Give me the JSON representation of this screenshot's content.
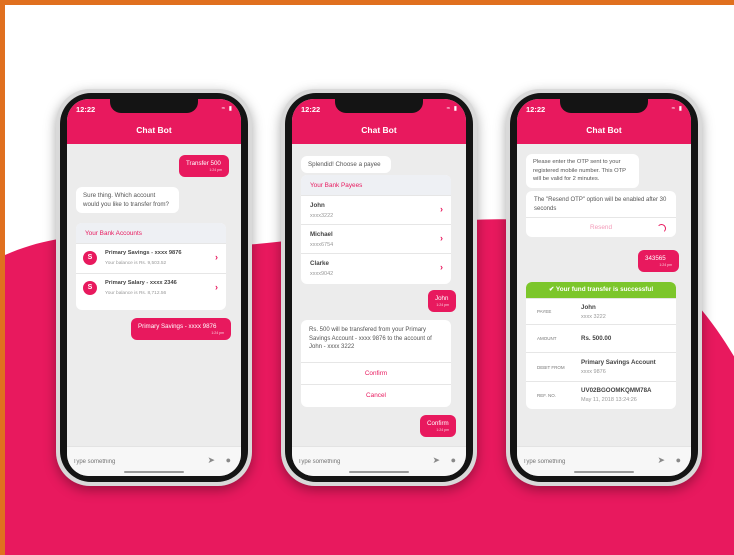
{
  "colors": {
    "accent": "#e8195e",
    "success": "#7cc62b",
    "frame": "#e0701f"
  },
  "common": {
    "time": "12:22",
    "title": "Chat Bot",
    "placeholder": "Type something",
    "send_icon": "send-icon",
    "mic_icon": "mic-icon",
    "tick": "1:24 pm"
  },
  "screen1": {
    "user_msg_1": "Transfer 500",
    "bot_msg_1": "Sure thing. Which account would you like to transfer from?",
    "accounts_title": "Your Bank Accounts",
    "accounts": [
      {
        "avatar": "S",
        "name": "Primary Savings - xxxx 9876",
        "balance": "Your balance is Rs. 9,503.52"
      },
      {
        "avatar": "S",
        "name": "Primary Salary - xxxx 2346",
        "balance": "Your balance is Rs. 8,712.56"
      }
    ],
    "user_msg_2": "Primary Savings - xxxx 9876"
  },
  "screen2": {
    "bot_msg_1": "Splendid! Choose a payee",
    "payees_title": "Your Bank Payees",
    "payees": [
      {
        "name": "John",
        "account": "xxxx3222"
      },
      {
        "name": "Michael",
        "account": "xxxx6754"
      },
      {
        "name": "Clarke",
        "account": "xxxx9042"
      }
    ],
    "user_msg_1": "John",
    "confirm_text": "Rs. 500 will be transfered from your Primary Savings Account - xxxx 9876 to the account of John - xxxx 3222",
    "confirm_label": "Confirm",
    "cancel_label": "Cancel",
    "user_msg_2": "Confirm"
  },
  "screen3": {
    "otp_msg": "Please enter the OTP sent to your registered mobile number. This OTP will be valid for 2 minutes.",
    "resend_info": "The \"Resend OTP\" option will be enabled after 30 seconds",
    "resend_label": "Resend",
    "user_otp": "343565",
    "success_title": "Your fund transfer is successful",
    "rows": [
      {
        "label": "PAYEE",
        "main": "John",
        "sub": "xxxx 3222"
      },
      {
        "label": "AMOUNT",
        "main": "Rs. 500.00",
        "sub": ""
      },
      {
        "label": "DEBIT FROM",
        "main": "Primary Savings Account",
        "sub": "xxxx 9876"
      },
      {
        "label": "REF. NO.",
        "main": "UV02BGOOMKQMM78A",
        "sub": "May 11, 2018 13:24:26"
      }
    ]
  }
}
